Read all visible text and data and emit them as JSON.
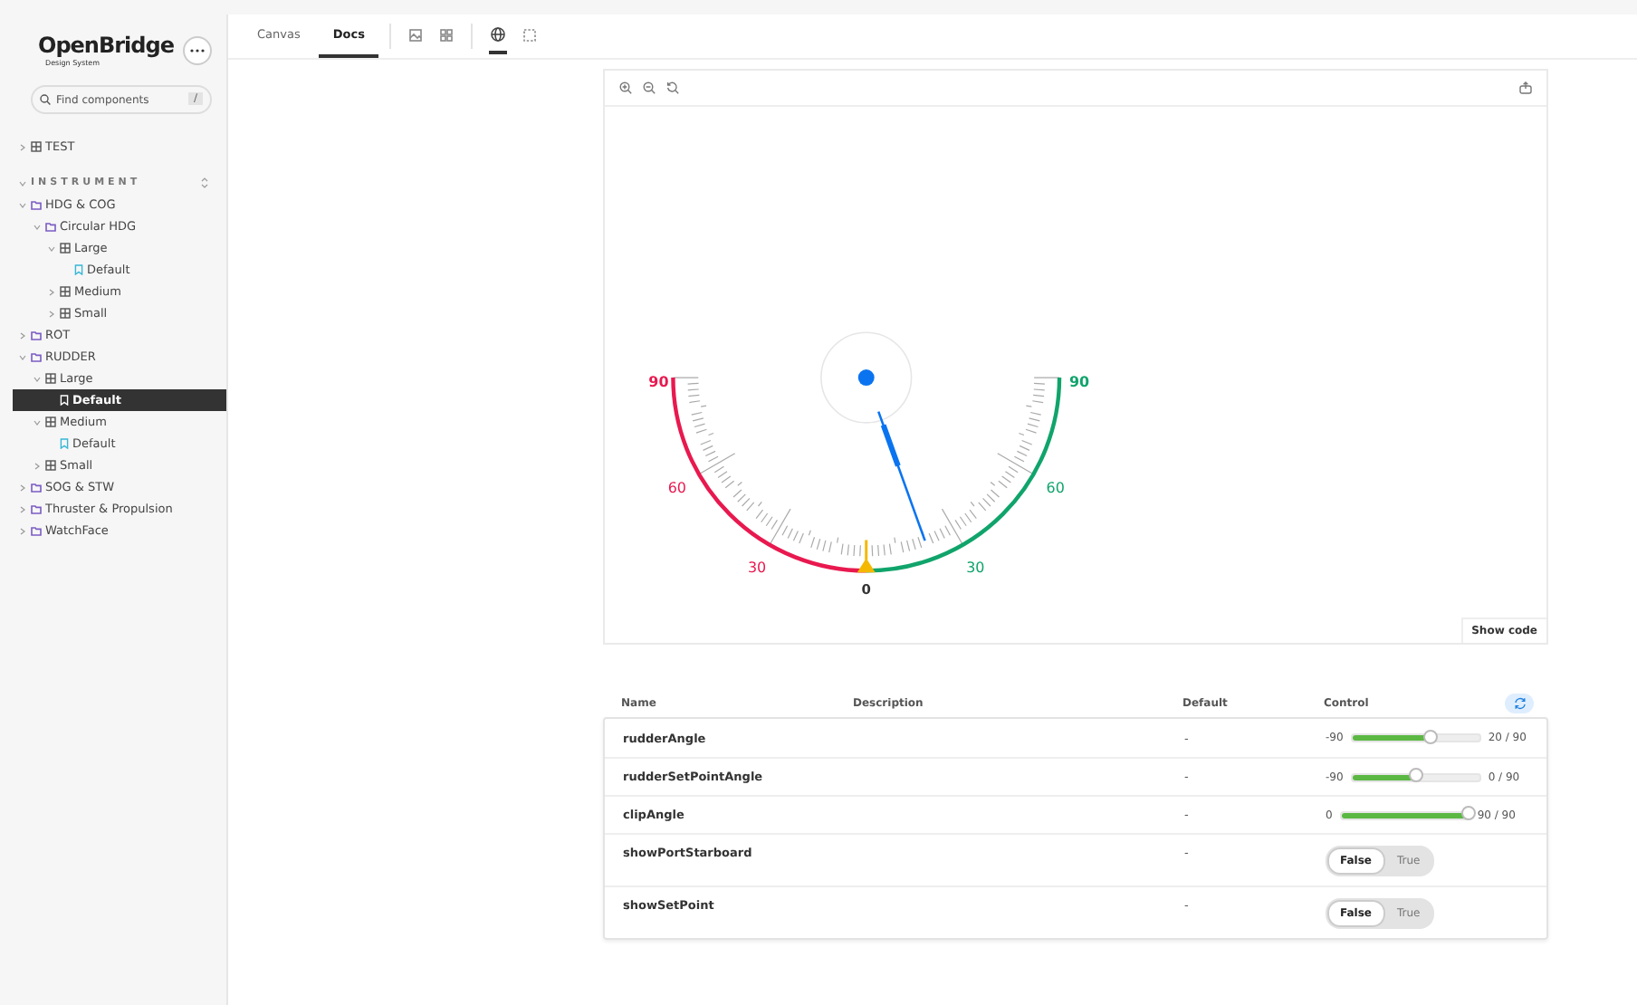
{
  "sidebar": {
    "logo": {
      "name": "OpenBridge",
      "subtitle": "Design System"
    },
    "search": {
      "placeholder": "Find components",
      "shortcut": "/"
    },
    "top_items": [
      {
        "label": "TEST",
        "kind": "component",
        "expanded": false,
        "selected": false
      }
    ],
    "section": {
      "title": "INSTRUMENT",
      "expanded": true
    },
    "tree": [
      {
        "label": "HDG & COG",
        "kind": "folder",
        "expanded": true,
        "selected": false,
        "children": [
          {
            "label": "Circular HDG",
            "kind": "folder",
            "expanded": true,
            "selected": false,
            "children": [
              {
                "label": "Large",
                "kind": "component",
                "expanded": true,
                "selected": false,
                "children": [
                  {
                    "label": "Default",
                    "kind": "story",
                    "selected": false
                  }
                ]
              },
              {
                "label": "Medium",
                "kind": "component",
                "expanded": false,
                "selected": false
              },
              {
                "label": "Small",
                "kind": "component",
                "expanded": false,
                "selected": false
              }
            ]
          }
        ]
      },
      {
        "label": "ROT",
        "kind": "folder",
        "expanded": false,
        "selected": false
      },
      {
        "label": "RUDDER",
        "kind": "folder",
        "expanded": true,
        "selected": false,
        "children": [
          {
            "label": "Large",
            "kind": "component",
            "expanded": true,
            "selected": false,
            "children": [
              {
                "label": "Default",
                "kind": "story",
                "selected": true
              }
            ]
          },
          {
            "label": "Medium",
            "kind": "component",
            "expanded": true,
            "selected": false,
            "children": [
              {
                "label": "Default",
                "kind": "story",
                "selected": false
              }
            ]
          },
          {
            "label": "Small",
            "kind": "component",
            "expanded": false,
            "selected": false
          }
        ]
      },
      {
        "label": "SOG & STW",
        "kind": "folder",
        "expanded": false,
        "selected": false
      },
      {
        "label": "Thruster & Propulsion",
        "kind": "folder",
        "expanded": false,
        "selected": false
      },
      {
        "label": "WatchFace",
        "kind": "folder",
        "expanded": false,
        "selected": false
      }
    ]
  },
  "tabs": [
    {
      "label": "Canvas",
      "selected": false
    },
    {
      "label": "Docs",
      "selected": true
    }
  ],
  "tools": [
    {
      "kind": "image",
      "selected": false
    },
    {
      "kind": "grid",
      "selected": false
    },
    {
      "kind": "globe",
      "selected": true
    },
    {
      "kind": "outline",
      "selected": false
    }
  ],
  "preview": {
    "gauge": {
      "port_labels": [
        "30",
        "60",
        "90"
      ],
      "center_label": "0",
      "starboard_labels": [
        "30",
        "60",
        "90"
      ]
    },
    "show_code": "Show code"
  },
  "table": {
    "columns": [
      "Name",
      "Description",
      "Default",
      "Control"
    ],
    "rows": [
      {
        "name": "rudderAngle",
        "default": "-",
        "kind": "slider",
        "min": "-90",
        "reading": "20 / 90",
        "level": 0.61
      },
      {
        "name": "rudderSetPointAngle",
        "default": "-",
        "kind": "slider",
        "min": "-90",
        "reading": "0 / 90",
        "level": 0.5
      },
      {
        "name": "clipAngle",
        "default": "-",
        "kind": "slider",
        "min": "0",
        "reading": "90 / 90",
        "level": 1
      },
      {
        "name": "showPortStarboard",
        "default": "-",
        "kind": "toggle",
        "options": [
          {
            "label": "False",
            "selected": true
          },
          {
            "label": "True",
            "selected": false
          }
        ]
      },
      {
        "name": "showSetPoint",
        "default": "-",
        "kind": "toggle",
        "options": [
          {
            "label": "False",
            "selected": true
          },
          {
            "label": "True",
            "selected": false
          }
        ]
      }
    ]
  }
}
